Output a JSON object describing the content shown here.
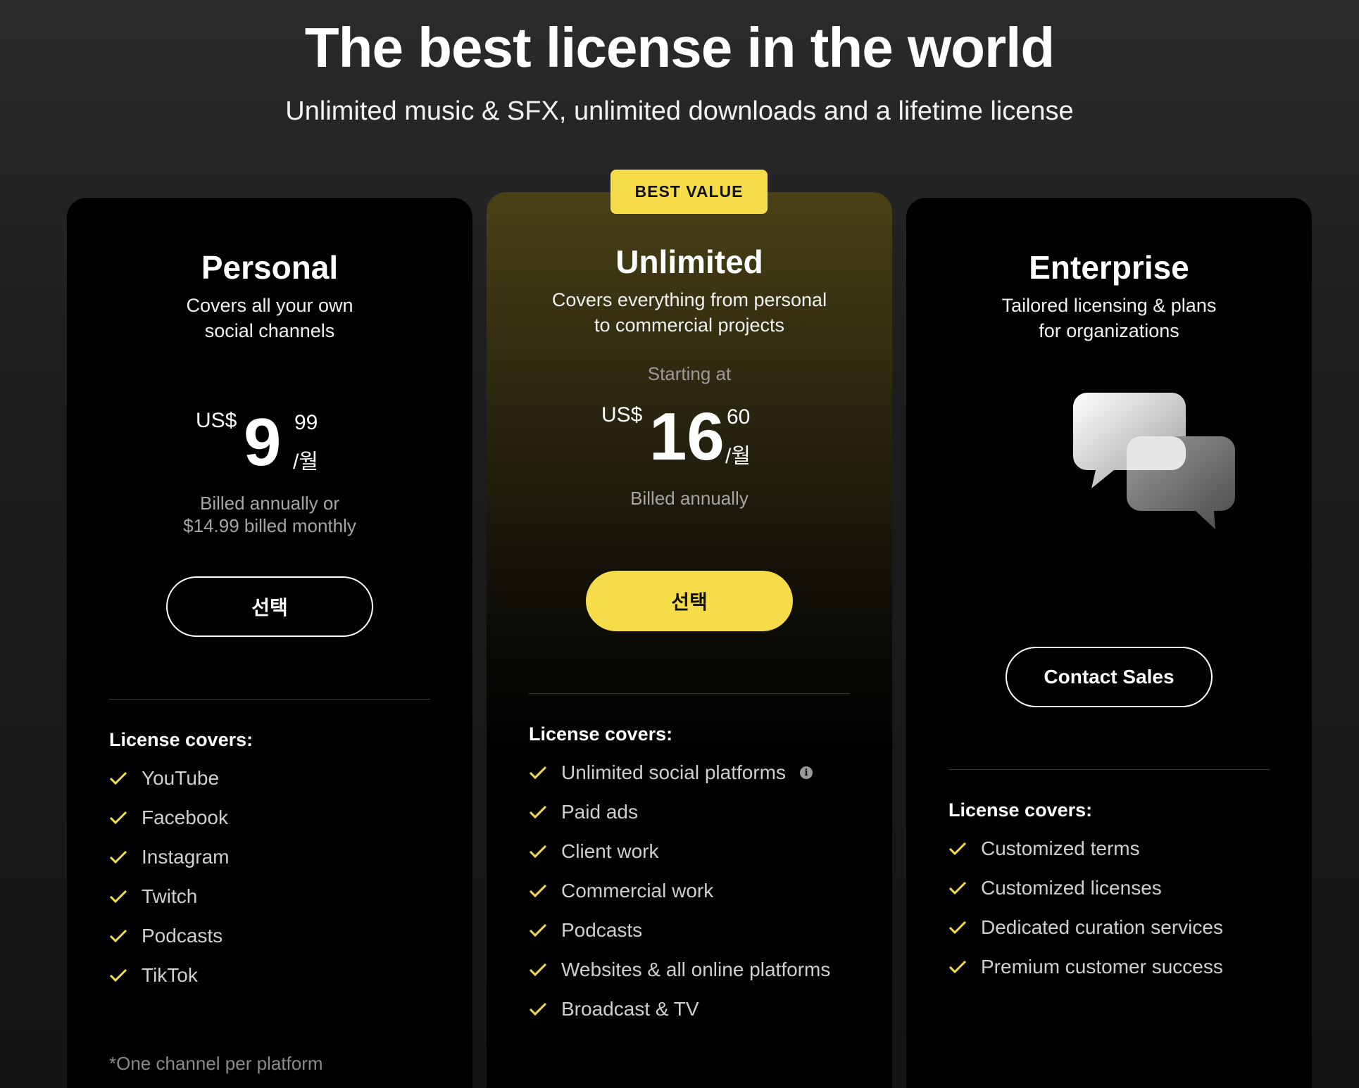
{
  "hero": {
    "title": "The best license in the world",
    "subtitle": "Unlimited music & SFX, unlimited downloads and a lifetime license"
  },
  "colors": {
    "accent": "#f7dc4a",
    "background": "#1d1d1e",
    "card": "#000000"
  },
  "plans": {
    "personal": {
      "name": "Personal",
      "desc_line1": "Covers all your own",
      "desc_line2": "social channels",
      "currency": "US$",
      "amount": "9",
      "cents": "99",
      "per": "/월",
      "billed_line1": "Billed annually or",
      "billed_line2": "$14.99 billed monthly",
      "cta": "선택",
      "covers_title": "License covers:",
      "features": [
        "YouTube",
        "Facebook",
        "Instagram",
        "Twitch",
        "Podcasts",
        "TikTok"
      ],
      "footnote": "*One channel per platform"
    },
    "unlimited": {
      "badge": "BEST VALUE",
      "name": "Unlimited",
      "desc_line1": "Covers everything from personal",
      "desc_line2": "to commercial projects",
      "starting": "Starting at",
      "currency": "US$",
      "amount": "16",
      "cents": "60",
      "per": "/월",
      "billed": "Billed annually",
      "cta": "선택",
      "covers_title": "License covers:",
      "features": [
        "Unlimited social platforms",
        "Paid ads",
        "Client work",
        "Commercial work",
        "Podcasts",
        "Websites & all online platforms",
        "Broadcast & TV"
      ],
      "info_glyph": "i"
    },
    "enterprise": {
      "name": "Enterprise",
      "desc_line1": "Tailored licensing & plans",
      "desc_line2": "for organizations",
      "icon": "chat-bubbles-icon",
      "cta": "Contact Sales",
      "covers_title": "License covers:",
      "features": [
        "Customized terms",
        "Customized licenses",
        "Dedicated curation services",
        "Premium customer success"
      ]
    }
  }
}
